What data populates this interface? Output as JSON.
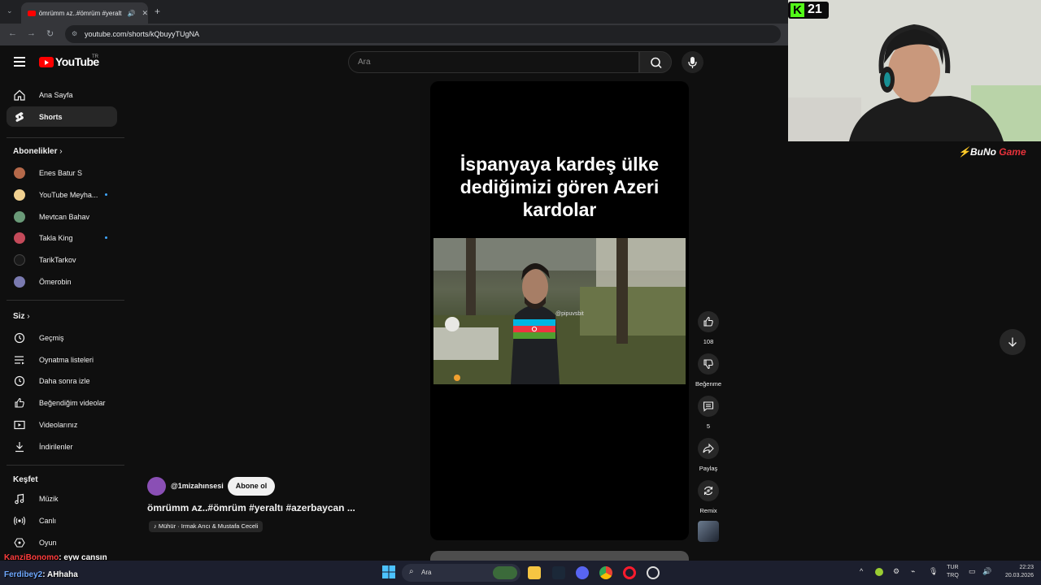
{
  "browser": {
    "tab_title": "ömrümm ᴀᴢ..#ömrüm #yeralt",
    "url": "youtube.com/shorts/kQbuyyTUgNA"
  },
  "header": {
    "logo_text": "YouTube",
    "region": "TR",
    "search_placeholder": "Ara"
  },
  "sidebar": {
    "main": [
      {
        "label": "Ana Sayfa",
        "icon": "home-icon"
      },
      {
        "label": "Shorts",
        "icon": "shorts-icon"
      }
    ],
    "subscriptions_header": "Abonelikler",
    "subscriptions": [
      {
        "label": "Enes Batur S",
        "color": "#b5694a"
      },
      {
        "label": "YouTube Meyha...",
        "color": "#f0d090",
        "new": true
      },
      {
        "label": "Mevtcan Bahav",
        "color": "#6a9a78"
      },
      {
        "label": "Takla King",
        "color": "#c44a5a",
        "new": true
      },
      {
        "label": "TarikTarkov",
        "color": "#1a1a1a"
      },
      {
        "label": "Ömerobin",
        "color": "#7a7ab0"
      }
    ],
    "you_header": "Siz",
    "you": [
      {
        "label": "Geçmiş",
        "icon": "history-icon"
      },
      {
        "label": "Oynatma listeleri",
        "icon": "playlists-icon"
      },
      {
        "label": "Daha sonra izle",
        "icon": "watch-later-icon"
      },
      {
        "label": "Beğendiğim videolar",
        "icon": "liked-videos-icon"
      },
      {
        "label": "Videolarınız",
        "icon": "your-videos-icon"
      },
      {
        "label": "İndirilenler",
        "icon": "downloads-icon"
      }
    ],
    "explore_header": "Keşfet",
    "explore": [
      {
        "label": "Müzik",
        "icon": "music-icon"
      },
      {
        "label": "Canlı",
        "icon": "live-icon"
      },
      {
        "label": "Oyun",
        "icon": "gaming-icon"
      }
    ]
  },
  "short": {
    "caption": "İspanyaya kardeş ülke dediğimizi gören Azeri kardolar",
    "watermark": "@pipuvsbit",
    "channel": "@1mizahınsesi",
    "subscribe_label": "Abone ol",
    "title": "ömrümm ᴀᴢ..#ömrüm #yeraltı #azerbaycan ...",
    "music": "Mühür · Irmak Arıcı & Mustafa Ceceli"
  },
  "actions": {
    "like_count": "108",
    "dislike_label": "Beğenme",
    "comment_count": "5",
    "share_label": "Paylaş",
    "remix_label": "Remix"
  },
  "stream": {
    "viewer_count": "21",
    "chat": [
      {
        "user": "KanziBonomo",
        "message": ": eyw cansın"
      },
      {
        "user": "Ferdibey2",
        "message": ": AHhaha"
      }
    ]
  },
  "taskbar": {
    "search_placeholder": "Ara",
    "lang_top": "TUR",
    "lang_bottom": "TRQ",
    "time": "22:23",
    "date": "20.03.2026"
  }
}
